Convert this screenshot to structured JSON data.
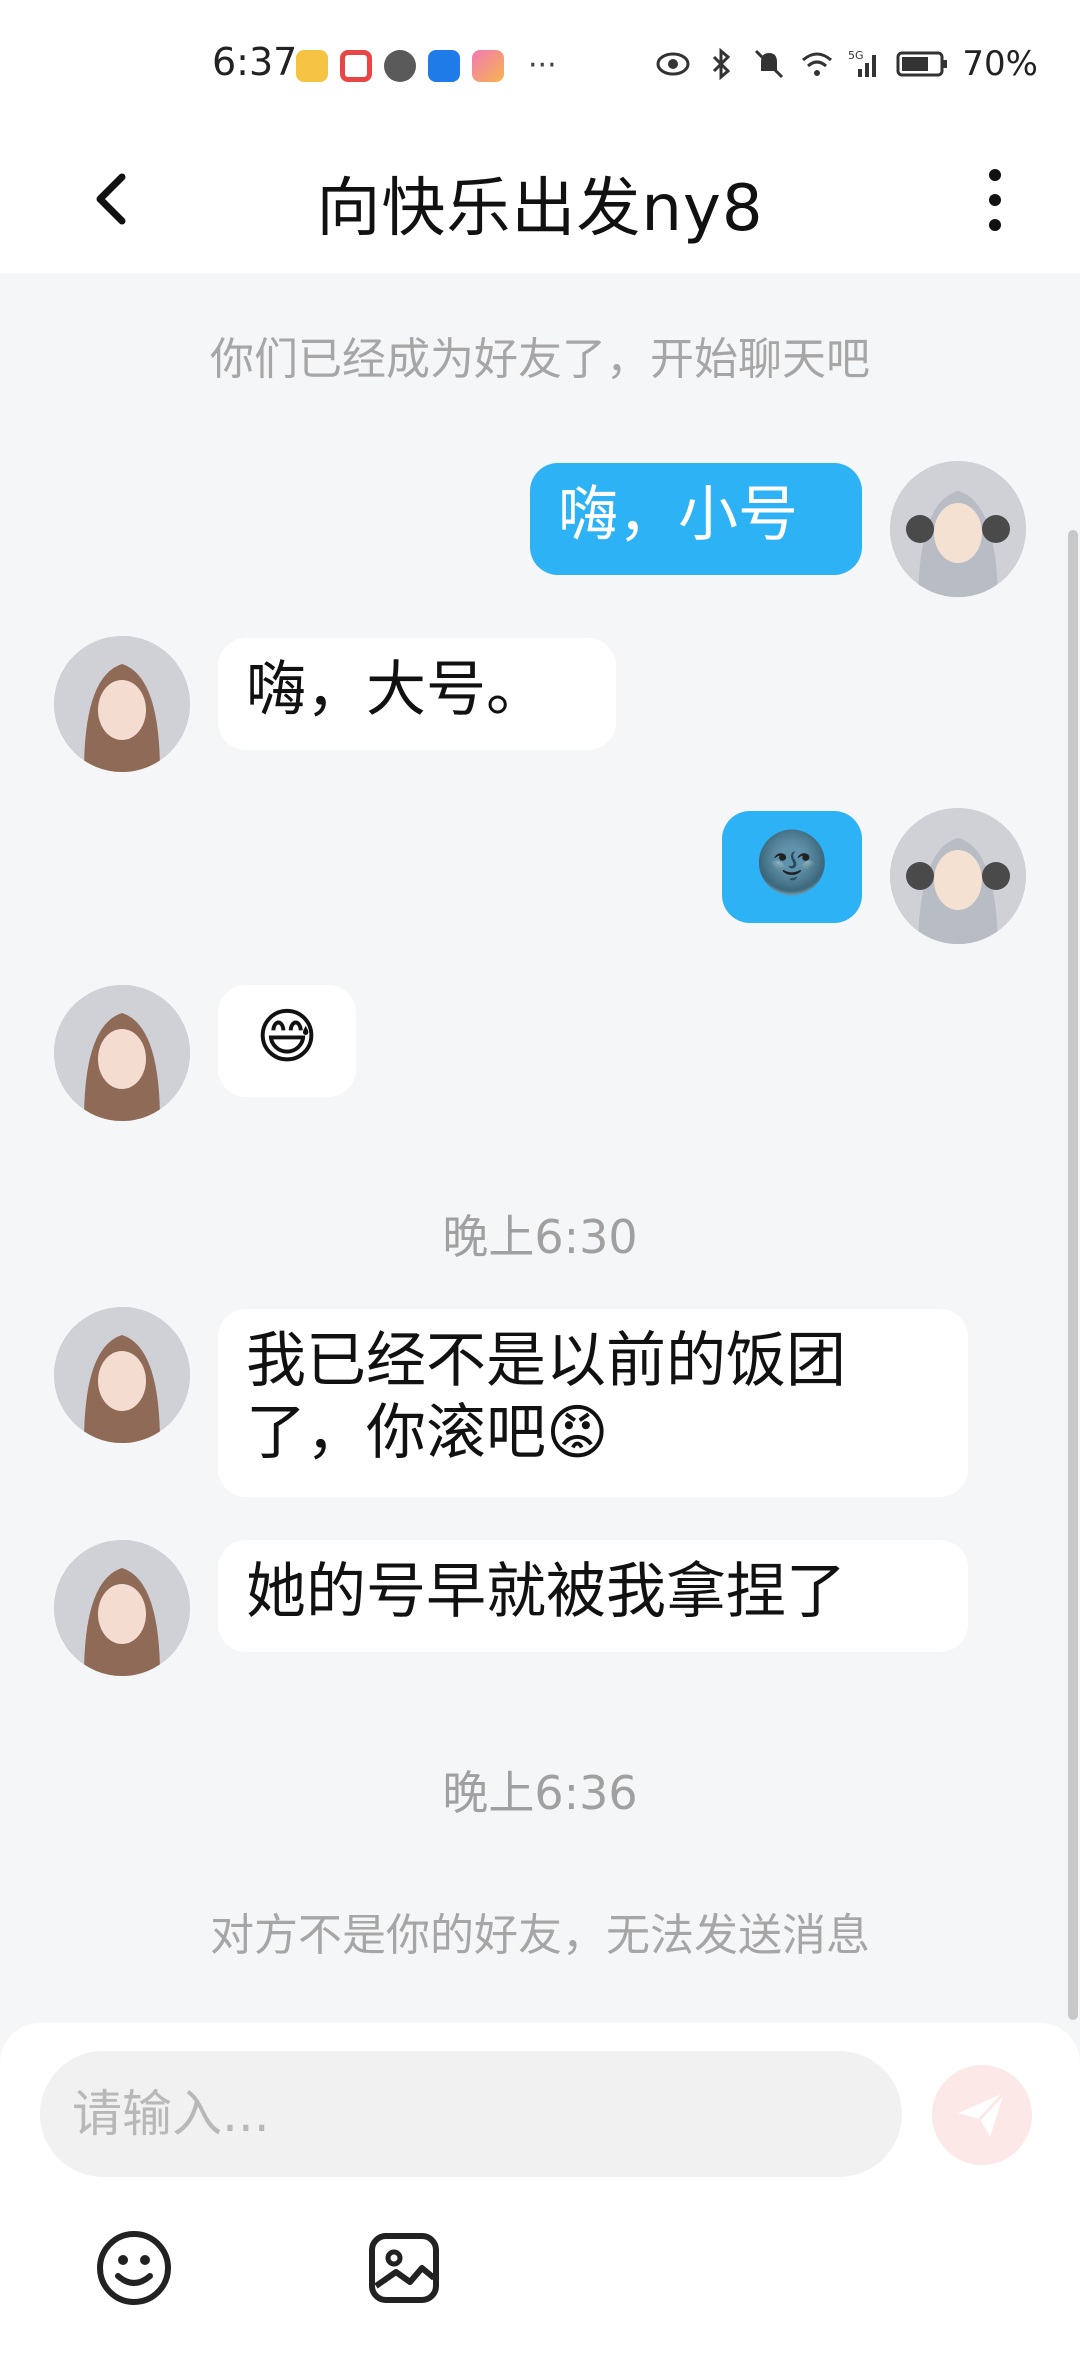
{
  "status_bar": {
    "time": "6:37",
    "more": "···",
    "battery": "70%"
  },
  "header": {
    "title": "向快乐出发ny8"
  },
  "chat": {
    "system_friends": "你们已经成为好友了，开始聊天吧",
    "messages": [
      {
        "side": "me",
        "text": "嗨，小号"
      },
      {
        "side": "them",
        "text": "嗨，大号。"
      },
      {
        "side": "me",
        "text": "🌚"
      },
      {
        "side": "them",
        "text": "😅"
      },
      {
        "side": "them",
        "text": "我已经不是以前的饭团了，你滚吧😡"
      },
      {
        "side": "them",
        "text": "她的号早就被我拿捏了"
      }
    ],
    "timestamp_1": "晚上6:30",
    "timestamp_2": "晚上6:36",
    "system_not_friend": "对方不是你的好友，无法发送消息"
  },
  "composer": {
    "placeholder": "请输入..."
  },
  "icons": {
    "back": "chevron-left-icon",
    "menu": "more-vertical-icon",
    "send": "send-icon",
    "emoji": "emoji-icon",
    "image": "image-icon"
  },
  "colors": {
    "my_bubble": "#2db2f6",
    "their_bubble": "#ffffff",
    "background": "#f5f6f8",
    "send_button": "#fde8e8"
  }
}
